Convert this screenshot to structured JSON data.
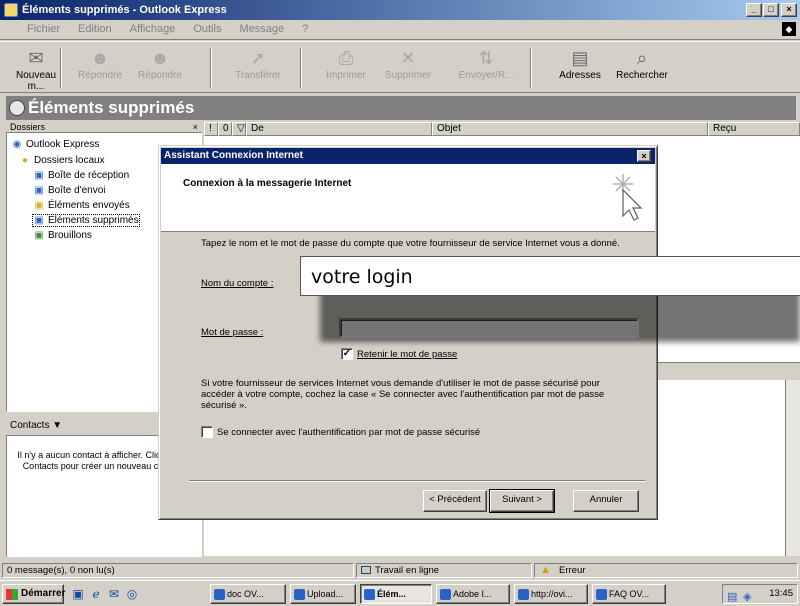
{
  "window": {
    "title": "Éléments supprimés - Outlook Express",
    "controls": [
      "_",
      "□",
      "×"
    ]
  },
  "menu": [
    "Fichier",
    "Edition",
    "Affichage",
    "Outils",
    "Message",
    "?"
  ],
  "toolbar": [
    {
      "label": "Nouveau m...",
      "icon": "new-mail-icon",
      "glyph": "✉",
      "enabled": true
    },
    {
      "label": "Répondre",
      "icon": "reply-icon",
      "glyph": "☻",
      "enabled": false
    },
    {
      "label": "Répondre",
      "icon": "reply-all-icon",
      "glyph": "☻",
      "enabled": false
    },
    {
      "label": "Transférer",
      "icon": "forward-icon",
      "glyph": "➚",
      "enabled": false
    },
    {
      "label": "Imprimer",
      "icon": "print-icon",
      "glyph": "⎙",
      "enabled": false
    },
    {
      "label": "Supprimer",
      "icon": "delete-icon",
      "glyph": "✕",
      "enabled": false
    },
    {
      "label": "Envoyer/R...",
      "icon": "send-receive-icon",
      "glyph": "⇅",
      "enabled": false
    },
    {
      "label": "Adresses",
      "icon": "address-book-icon",
      "glyph": "▤",
      "enabled": true
    },
    {
      "label": "Rechercher",
      "icon": "find-icon",
      "glyph": "⌕",
      "enabled": true
    }
  ],
  "folder_header": "Éléments supprimés",
  "folders": {
    "header": "Dossiers",
    "items": [
      {
        "label": "Outlook Express",
        "glyph": "◉",
        "color": "#2a62c5"
      },
      {
        "label": "Dossiers locaux",
        "glyph": "●",
        "color": "#d7b02a"
      },
      {
        "label": "Boîte de réception",
        "glyph": "▣",
        "color": "#2a62c5"
      },
      {
        "label": "Boîte d'envoi",
        "glyph": "▣",
        "color": "#2a62c5"
      },
      {
        "label": "Éléments envoyés",
        "glyph": "▣",
        "color": "#d7b02a"
      },
      {
        "label": "Éléments supprimés",
        "glyph": "▣",
        "color": "#2a62c5"
      },
      {
        "label": "Brouillons",
        "glyph": "▣",
        "color": "#3a8a3a"
      }
    ]
  },
  "contacts": {
    "header": "Contacts ▼",
    "empty_text": "Il n'y a aucun contact à afficher. Cliquez sur Contacts pour créer un nouveau contact."
  },
  "list_columns": [
    "!",
    "0",
    "▽",
    "De",
    "Objet",
    "Reçu"
  ],
  "dialog": {
    "title": "Assistant Connexion Internet",
    "close": "×",
    "subtitle": "Connexion à la messagerie Internet",
    "intro": "Tapez le nom et le mot de passe du compte que votre fournisseur de service Internet vous a donné.",
    "account_label": "Nom du compte :",
    "password_label": "Mot de passe :",
    "remember_label": "Retenir le mot de passe",
    "remember_checked": true,
    "spa_text": "Si votre fournisseur de services Internet vous demande d'utiliser le mot de passe sécurisé pour accéder à votre compte, cochez la case « Se connecter avec l'authentification par mot de passe sécurisé ».",
    "spa_label": "Se connecter avec l'authentification par mot de passe sécurisé",
    "spa_checked": false,
    "back_button": "< Précédent",
    "next_button": "Suivant >",
    "cancel_button": "Annuler"
  },
  "login_overlay": "votre login",
  "status": {
    "messages": "0 message(s), 0 non lu(s)",
    "online": "Travail en ligne",
    "error": "Erreur"
  },
  "taskbar": {
    "start": "Démarrer",
    "tasks": [
      {
        "label": "doc OV...",
        "active": false
      },
      {
        "label": "Upload...",
        "active": false
      },
      {
        "label": "Élém...",
        "active": true
      },
      {
        "label": "Adobe I...",
        "active": false
      },
      {
        "label": "http://ovi...",
        "active": false
      },
      {
        "label": "FAQ OV...",
        "active": false
      }
    ],
    "clock": "13:45"
  }
}
